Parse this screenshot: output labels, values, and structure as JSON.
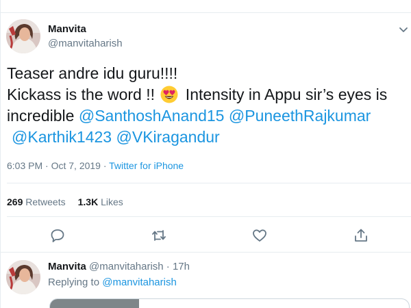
{
  "tweet": {
    "author_name": "Manvita",
    "author_handle": "@manvitaharish",
    "text_line1": "Teaser andre idu guru!!!!",
    "text_line2_pre": "Kickass is the word !! ",
    "emoji": "smiling-face-with-heart-eyes",
    "text_line2_post": " Intensity in Appu sir’s eyes is",
    "text_line3_pre": "incredible ",
    "mention1": "@SanthoshAnand15",
    "mention2": "@PuneethRajkumar",
    "mention3": "@Karthik1423",
    "mention4": "@VKiragandur",
    "timestamp": "6:03 PM · Oct 7, 2019 · ",
    "source": "Twitter for iPhone",
    "retweets_count": "269",
    "retweets_label": "Retweets",
    "likes_count": "1.3K",
    "likes_label": "Likes"
  },
  "reply": {
    "author_name": "Manvita",
    "handle_time": "@manvitaharish · 17h",
    "replying_label": "Replying to ",
    "replying_handle": "@manvitaharish"
  },
  "colors": {
    "link": "#1b95e0",
    "secondary_text": "#657786",
    "primary_text": "#14171a",
    "divider": "#e6ecf0"
  },
  "icons": [
    "chevron-down-icon",
    "reply-icon",
    "retweet-icon",
    "like-icon",
    "share-icon"
  ]
}
